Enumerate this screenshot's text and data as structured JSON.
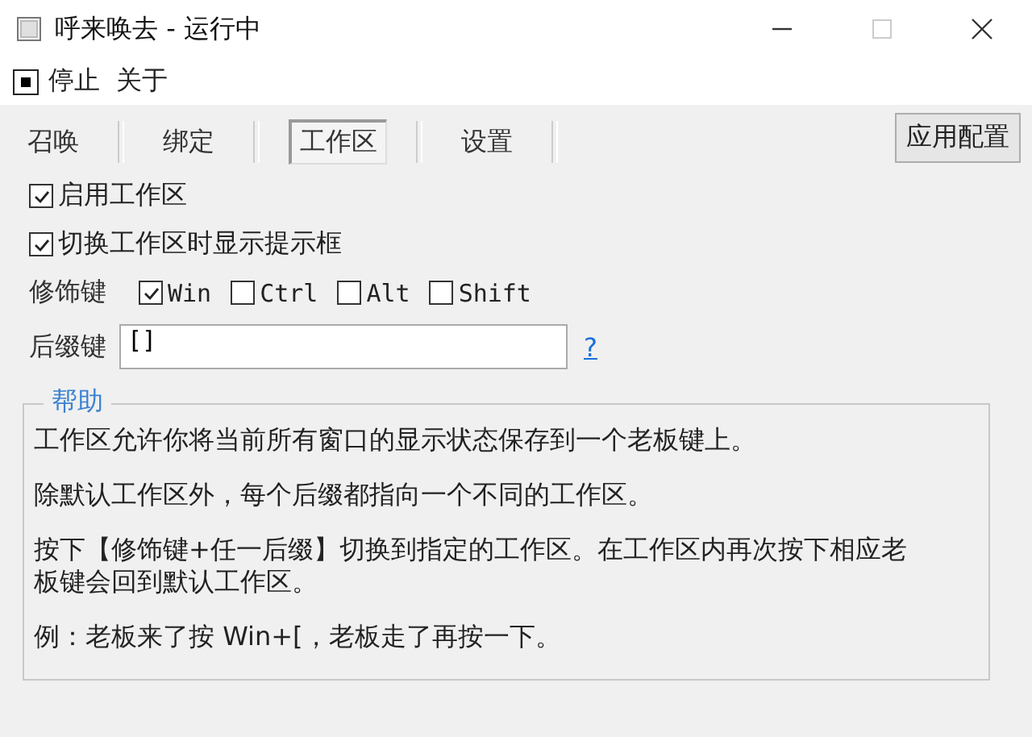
{
  "window": {
    "title": "呼来唤去 - 运行中",
    "maximize_disabled": true
  },
  "menu": [
    {
      "label": "停止",
      "kind": "stop"
    },
    {
      "label": "关于",
      "kind": "plain"
    }
  ],
  "tabs": [
    {
      "label": "召唤",
      "selected": false
    },
    {
      "label": "绑定",
      "selected": false
    },
    {
      "label": "工作区",
      "selected": true
    },
    {
      "label": "设置",
      "selected": false
    }
  ],
  "apply_button": "应用配置",
  "options": [
    {
      "label": "启用工作区",
      "checked": true
    },
    {
      "label": "切换工作区时显示提示框",
      "checked": true
    }
  ],
  "modifiers": {
    "label": "修饰键",
    "keys": [
      {
        "label": "Win",
        "checked": true
      },
      {
        "label": "Ctrl",
        "checked": false
      },
      {
        "label": "Alt",
        "checked": false
      },
      {
        "label": "Shift",
        "checked": false
      }
    ]
  },
  "suffix": {
    "label": "后缀键",
    "value": "[]",
    "help_link": "?"
  },
  "help": {
    "title": "帮助",
    "paragraphs": [
      "工作区允许你将当前所有窗口的显示状态保存到一个老板键上。",
      "除默认工作区外，每个后缀都指向一个不同的工作区。",
      "按下【修饰键+任一后缀】切换到指定的工作区。在工作区内再次按下相应老板键会回到默认工作区。",
      "例：老板来了按 Win+[，老板走了再按一下。"
    ]
  }
}
